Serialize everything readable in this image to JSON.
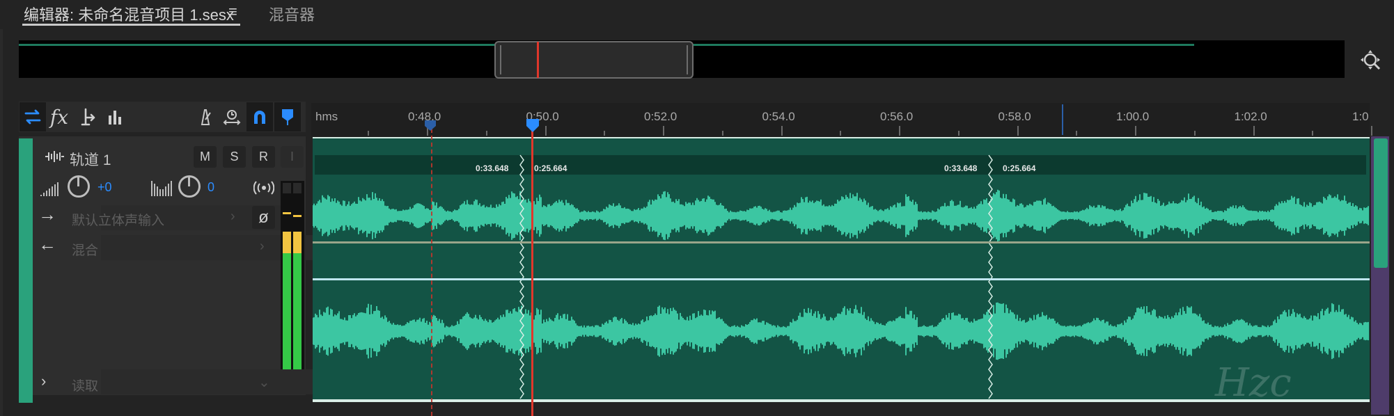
{
  "tabs": {
    "editor_label": "编辑器: 未命名混音项目 1.sesx",
    "menu_glyph": "≡",
    "mixer_label": "混音器"
  },
  "toolbar": {
    "fx_label": "fx"
  },
  "track": {
    "name": "轨道 1",
    "mute": "M",
    "solo": "S",
    "record": "R",
    "input_monitor": "I",
    "volume_value": "+0",
    "pan_value": "0",
    "input_label": "默认立体声输入",
    "output_label": "混合",
    "automation_mode": "读取",
    "color": "#2aa27c"
  },
  "timeline": {
    "ruler_unit": "hms",
    "ticks": [
      "0:48.0",
      "0:50.0",
      "0:52.0",
      "0:54.0",
      "0:56.0",
      "0:58.0",
      "1:00.0",
      "1:02.0",
      "1:0"
    ],
    "clip_markers": [
      {
        "left": "0:33.648",
        "right": "0:25.664"
      },
      {
        "left": "0:33.648",
        "right": "0:25.664"
      }
    ]
  },
  "colors": {
    "accent": "#2b8cff",
    "waveform": "#3cc6a2",
    "clip_bg": "#135445",
    "playhead": "#e0372b"
  },
  "watermark": "Hzc"
}
